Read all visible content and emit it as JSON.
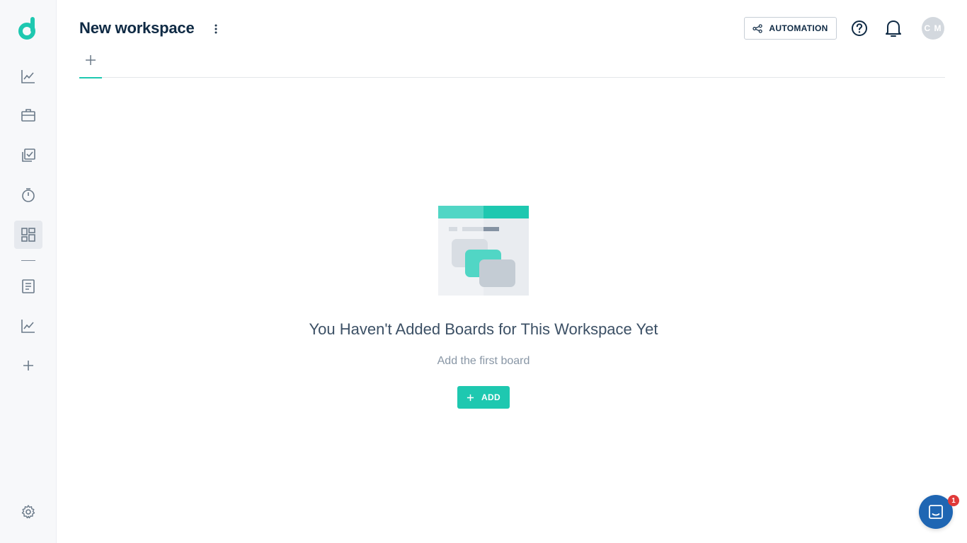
{
  "header": {
    "title": "New workspace",
    "automation_label": "AUTOMATION",
    "avatar_initials": "C M"
  },
  "sidebar": {
    "items": [
      {
        "icon": "chart-line-icon"
      },
      {
        "icon": "briefcase-icon"
      },
      {
        "icon": "copy-check-icon"
      },
      {
        "icon": "timer-icon"
      },
      {
        "icon": "dashboard-grid-icon",
        "active": true
      },
      {
        "icon": "document-icon"
      },
      {
        "icon": "chart-line-icon"
      },
      {
        "icon": "plus-icon"
      }
    ],
    "footer_icon": "gear-icon"
  },
  "empty_state": {
    "title": "You Haven't Added Boards for This Workspace Yet",
    "subtitle": "Add the first board",
    "add_label": "ADD"
  },
  "chat": {
    "badge_count": "1"
  },
  "colors": {
    "accent": "#1ec8b0",
    "primary_text": "#0f2a44",
    "chat_blue": "#1f66b3",
    "badge_red": "#e03a3a"
  }
}
